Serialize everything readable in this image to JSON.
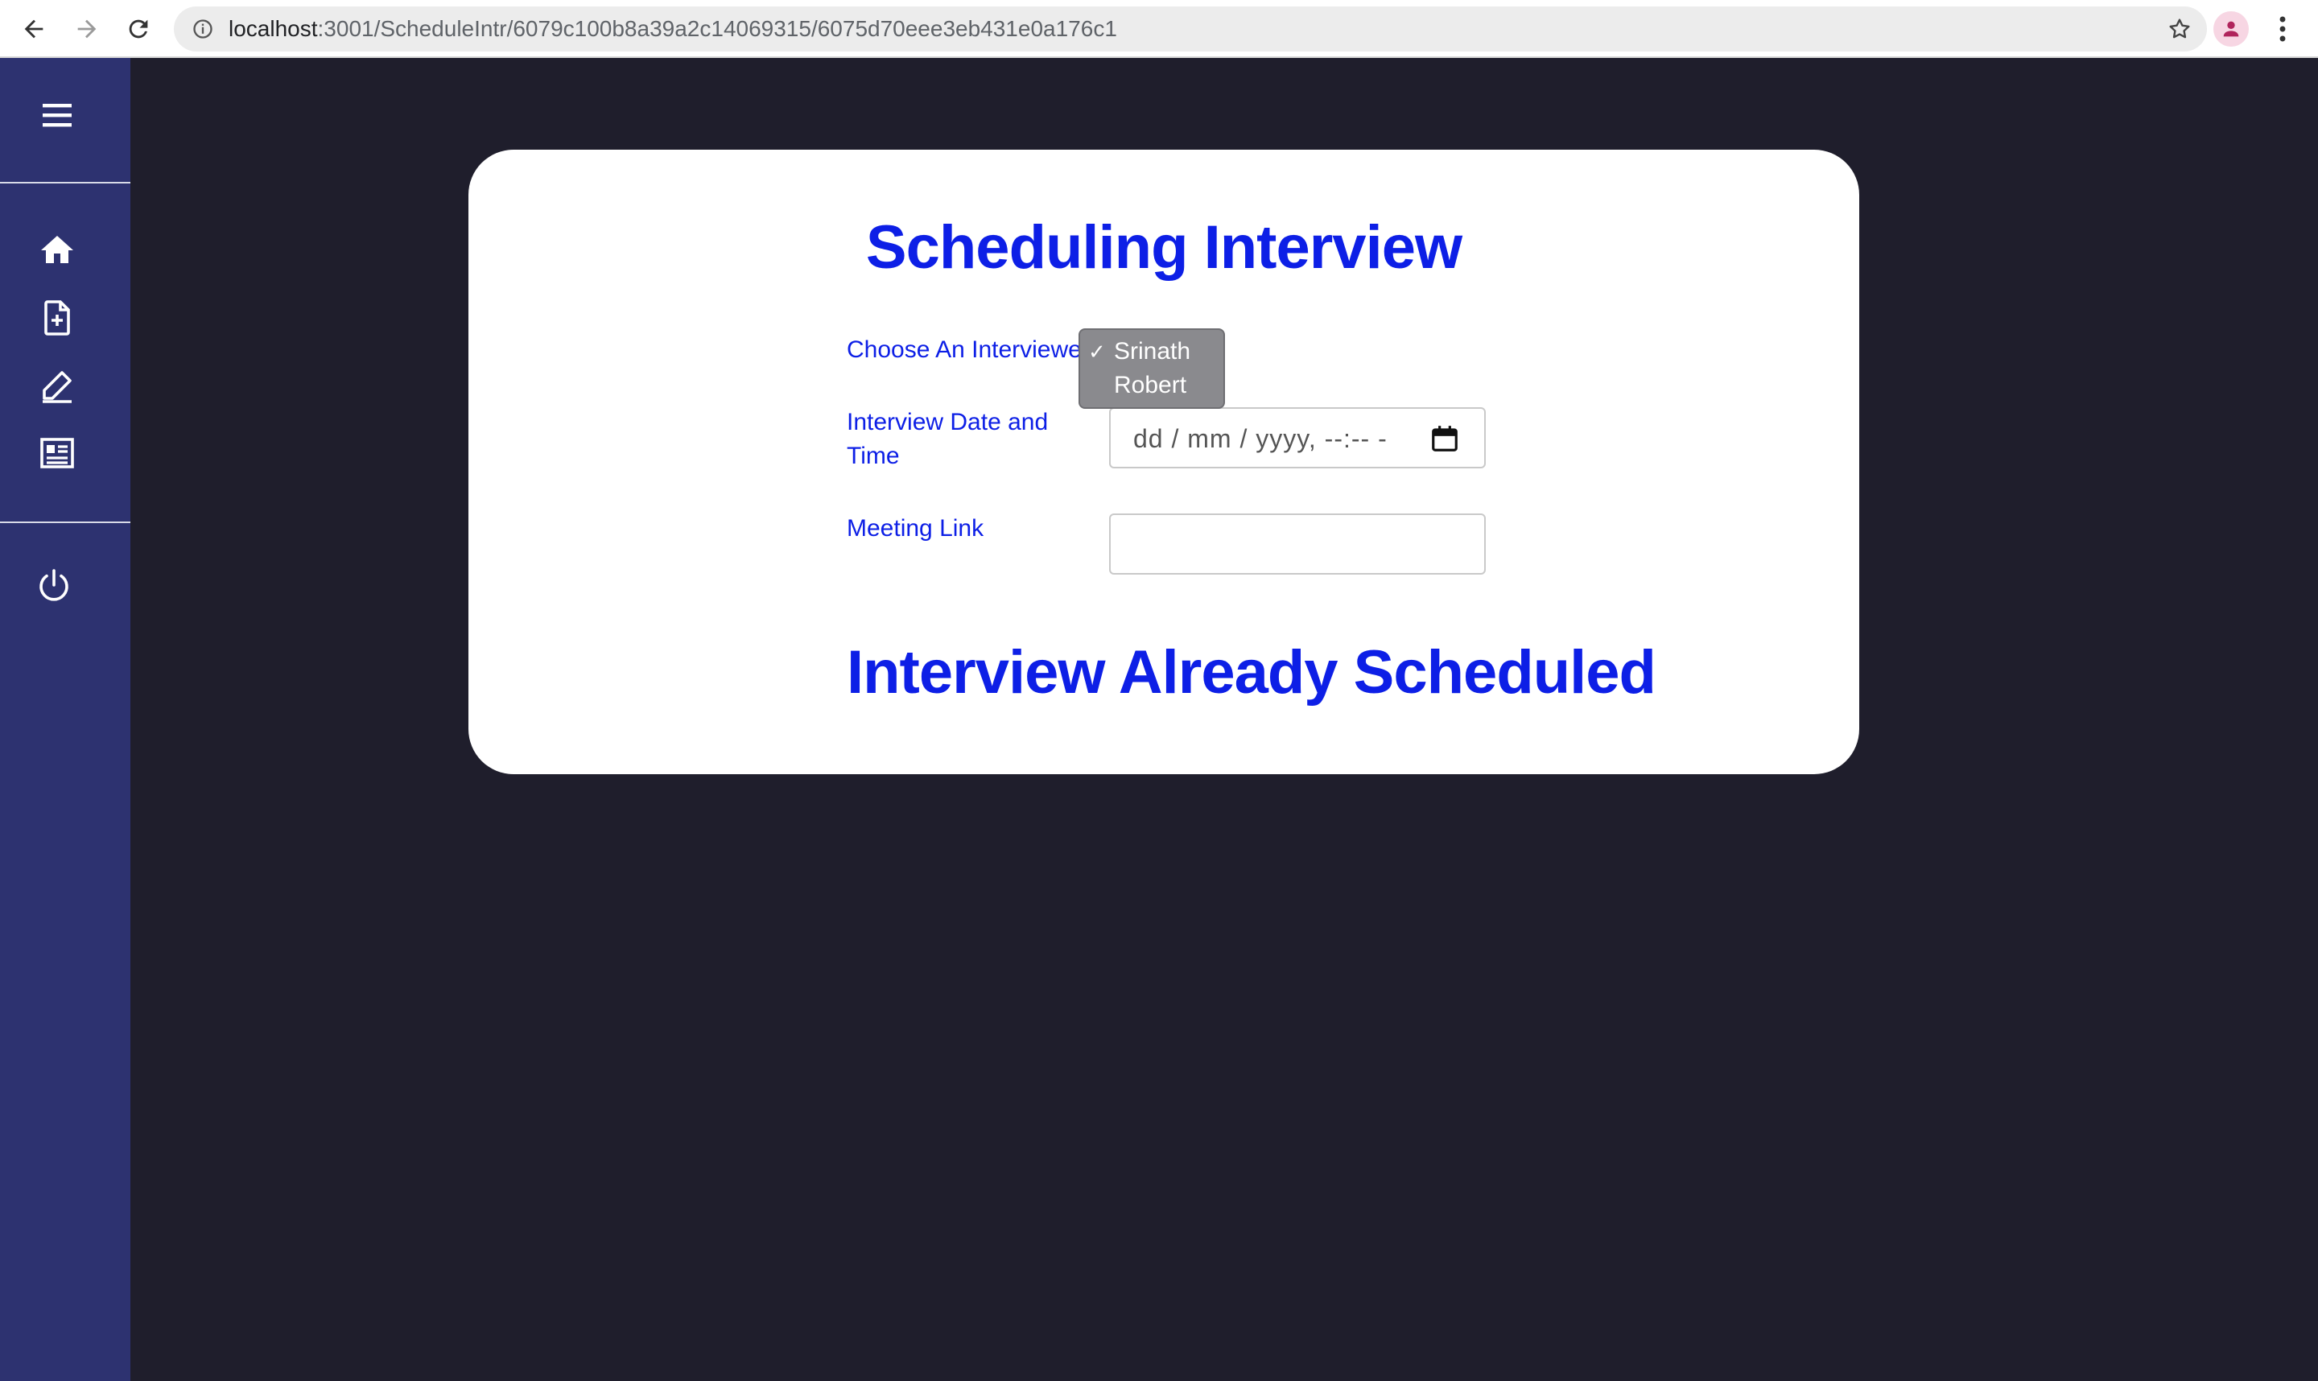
{
  "browser": {
    "url_host": "localhost",
    "url_path": ":3001/ScheduleIntr/6079c100b8a39a2c14069315/6075d70eee3eb431e0a176c1"
  },
  "form": {
    "title": "Scheduling Interview",
    "interviewer_label": "Choose An Interviewer",
    "interviewer_options": [
      {
        "label": "Srinath",
        "checked_mark": "✓"
      },
      {
        "label": "Robert",
        "checked_mark": ""
      }
    ],
    "datetime_label_line1": "Interview Date and",
    "datetime_label_line2": "Time",
    "datetime_placeholder": "dd / mm / yyyy, --:-- -",
    "meeting_link_label": "Meeting Link",
    "meeting_link_value": "",
    "status_message": "Interview Already Scheduled"
  },
  "colors": {
    "accent": "#0d1fe6",
    "sidebar": "#2d3270",
    "background": "#1f1e2c"
  }
}
